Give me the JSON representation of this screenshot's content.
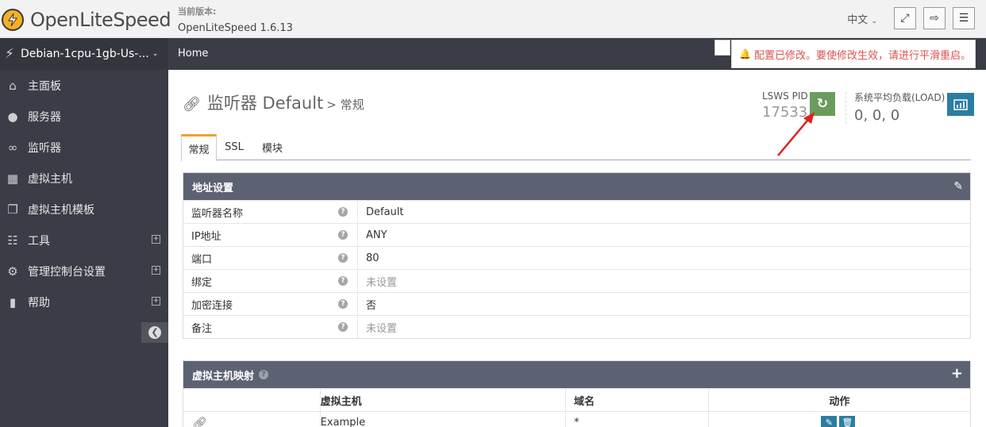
{
  "header": {
    "logo_text": "OpenLiteSpeed",
    "version_label": "当前版本:",
    "version_value": "OpenLiteSpeed 1.6.13",
    "lang": "中文"
  },
  "sidebar": {
    "server_name": "Debian-1cpu-1gb-Us-...",
    "items": [
      {
        "label": "主面板",
        "icon": "home-icon",
        "expandable": false
      },
      {
        "label": "服务器",
        "icon": "globe-icon",
        "expandable": false
      },
      {
        "label": "监听器",
        "icon": "link-icon",
        "expandable": false
      },
      {
        "label": "虚拟主机",
        "icon": "cubes-icon",
        "expandable": false
      },
      {
        "label": "虚拟主机模板",
        "icon": "copy-icon",
        "expandable": false
      },
      {
        "label": "工具",
        "icon": "grid-icon",
        "expandable": true
      },
      {
        "label": "管理控制台设置",
        "icon": "gear-icon",
        "expandable": true
      },
      {
        "label": "帮助",
        "icon": "book-icon",
        "expandable": true
      }
    ]
  },
  "navbar": {
    "breadcrumb": "Home"
  },
  "alert": {
    "text": "配置已修改。要使修改生效，请进行平滑重启。"
  },
  "page": {
    "title": "监听器 Default",
    "subtitle": "> 常规",
    "pid_label": "LSWS PID",
    "pid_value": "17533",
    "load_label": "系统平均负载(LOAD)",
    "load_value": "0, 0, 0"
  },
  "tabs": [
    "常规",
    "SSL",
    "模块"
  ],
  "address_panel": {
    "title": "地址设置",
    "rows": [
      {
        "key": "监听器名称",
        "value": "Default",
        "muted": false
      },
      {
        "key": "IP地址",
        "value": "ANY",
        "muted": false
      },
      {
        "key": "端口",
        "value": "80",
        "muted": false
      },
      {
        "key": "绑定",
        "value": "未设置",
        "muted": true
      },
      {
        "key": "加密连接",
        "value": "否",
        "muted": false
      },
      {
        "key": "备注",
        "value": "未设置",
        "muted": true
      }
    ]
  },
  "vhost_panel": {
    "title": "虚拟主机映射",
    "columns": [
      "虚拟主机",
      "域名",
      "动作"
    ],
    "rows": [
      {
        "vhost": "Example",
        "domain": "*"
      }
    ]
  },
  "colors": {
    "sidebar_bg": "#3b3d46",
    "panel_head": "#5c6272",
    "restart_green": "#6a9c5e",
    "accent_blue": "#2b7ea1",
    "alert_red": "#d9534f",
    "tab_accent": "#f0a030"
  }
}
